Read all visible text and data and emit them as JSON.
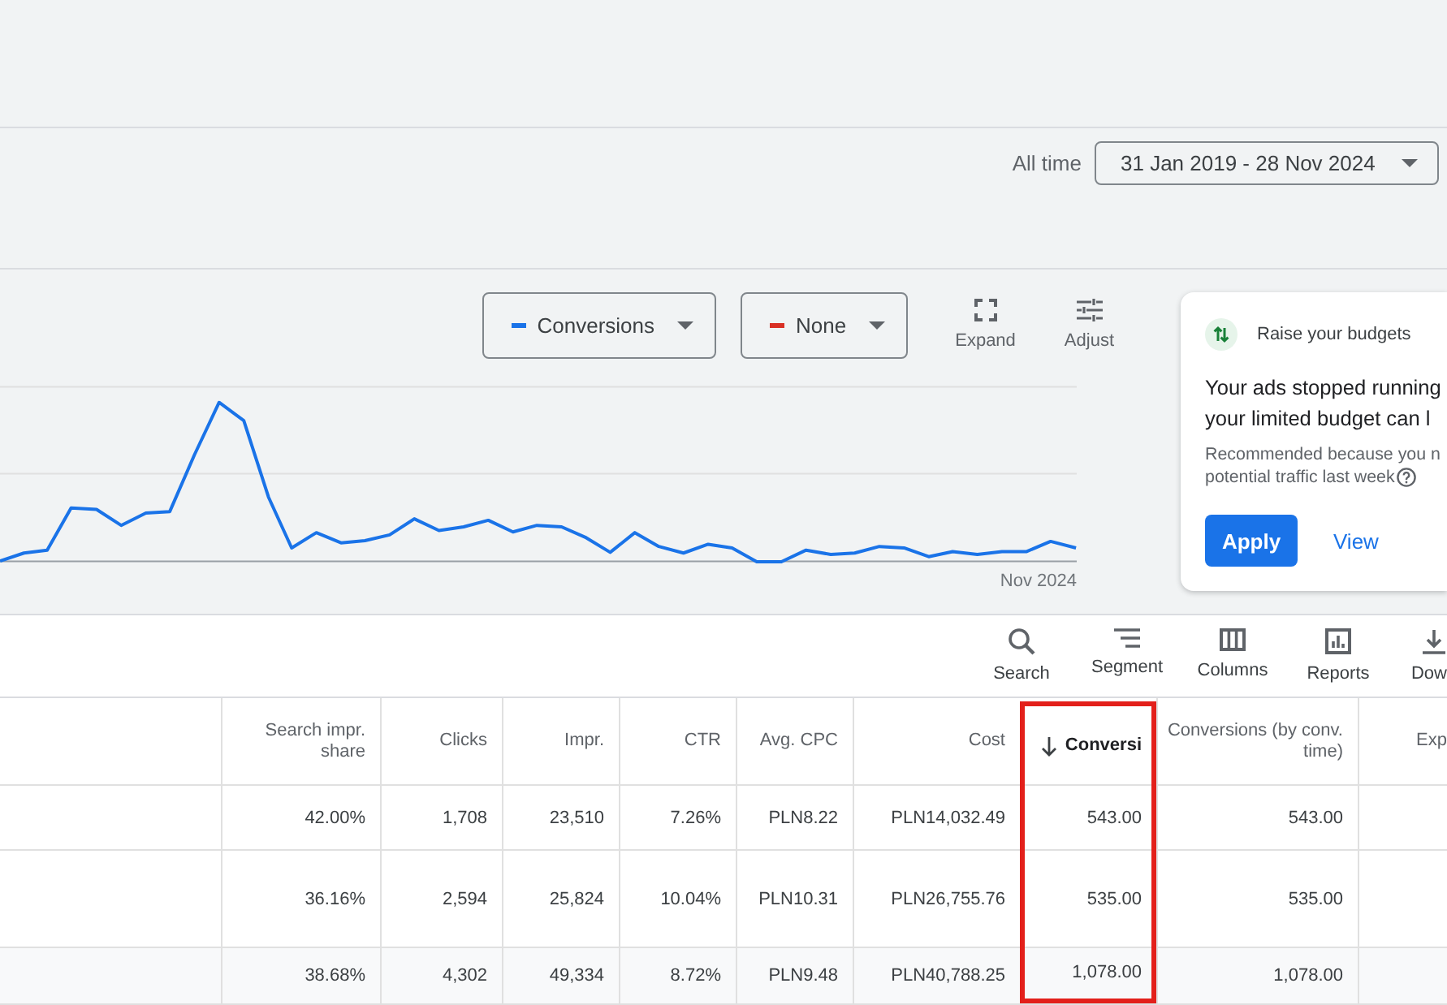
{
  "date_range": {
    "label": "All time",
    "value": "31 Jan 2019 - 28 Nov 2024"
  },
  "chart": {
    "metrics": [
      {
        "label": "Conversions",
        "color": "#1a73e8"
      },
      {
        "label": "None",
        "color": "#d93025"
      }
    ],
    "actions": [
      {
        "kind": "expand",
        "label": "Expand"
      },
      {
        "kind": "adjust",
        "label": "Adjust"
      }
    ],
    "x_axis_label": "Nov 2024"
  },
  "recommendation": {
    "title": "Raise your budgets",
    "body_lines": [
      "Your ads stopped running",
      "your limited budget can l"
    ],
    "note_lines": [
      "Recommended because you n",
      "potential traffic last week"
    ],
    "buttons": [
      {
        "kind": "primary",
        "label": "Apply"
      },
      {
        "kind": "link",
        "label": "View"
      }
    ]
  },
  "toolbar": [
    {
      "kind": "search",
      "label": "Search"
    },
    {
      "kind": "segment",
      "label": "Segment"
    },
    {
      "kind": "columns",
      "label": "Columns"
    },
    {
      "kind": "reports",
      "label": "Reports"
    },
    {
      "kind": "download",
      "label": "Dow"
    }
  ],
  "table": {
    "columns": [
      {
        "label": "Search impr. share",
        "sorted": false,
        "highlighted": false
      },
      {
        "label": "Clicks",
        "sorted": false,
        "highlighted": false
      },
      {
        "label": "Impr.",
        "sorted": false,
        "highlighted": false
      },
      {
        "label": "CTR",
        "sorted": false,
        "highlighted": false
      },
      {
        "label": "Avg. CPC",
        "sorted": false,
        "highlighted": false
      },
      {
        "label": "Cost",
        "sorted": false,
        "highlighted": false
      },
      {
        "label": "Conversi",
        "sorted": true,
        "highlighted": true
      },
      {
        "label": "Conversions (by conv. time)",
        "sorted": false,
        "highlighted": false
      },
      {
        "label": "Exp",
        "sorted": false,
        "highlighted": false
      }
    ],
    "rows": [
      {
        "kind": "data",
        "cells": [
          "42.00%",
          "1,708",
          "23,510",
          "7.26%",
          "PLN8.22",
          "PLN14,032.49",
          "543.00",
          "543.00"
        ]
      },
      {
        "kind": "data",
        "cells": [
          "36.16%",
          "2,594",
          "25,824",
          "10.04%",
          "PLN10.31",
          "PLN26,755.76",
          "535.00",
          "535.00"
        ]
      },
      {
        "kind": "total",
        "cells": [
          "38.68%",
          "4,302",
          "49,334",
          "8.72%",
          "PLN9.48",
          "PLN40,788.25",
          "1,078.00",
          "1,078.00"
        ]
      }
    ]
  }
}
